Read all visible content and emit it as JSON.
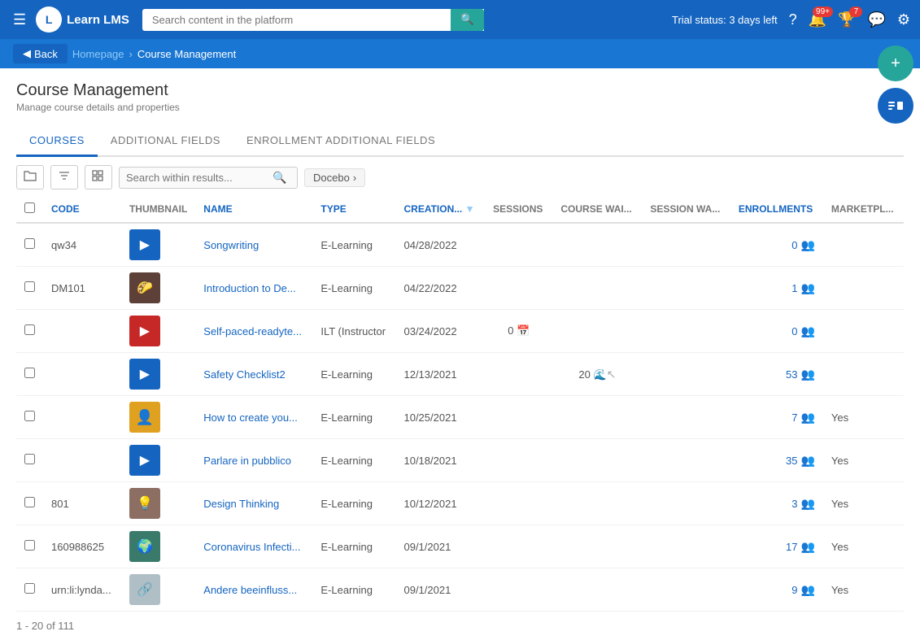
{
  "topNav": {
    "logoText": "L",
    "appName": "Learn LMS",
    "searchPlaceholder": "Search content in the platform",
    "trialStatus": "Trial status: 3 days left",
    "notifBadge": "99+",
    "rewardBadge": "7"
  },
  "breadcrumb": {
    "backLabel": "Back",
    "homepageLabel": "Homepage",
    "currentLabel": "Course Management"
  },
  "page": {
    "title": "Course Management",
    "subtitle": "Manage course details and properties"
  },
  "tabs": [
    {
      "label": "COURSES",
      "active": true
    },
    {
      "label": "ADDITIONAL FIELDS",
      "active": false
    },
    {
      "label": "ENROLLMENT ADDITIONAL FIELDS",
      "active": false
    }
  ],
  "toolbar": {
    "searchPlaceholder": "Search within results...",
    "doceboTag": "Docebo"
  },
  "table": {
    "columns": [
      "CODE",
      "THUMBNAIL",
      "NAME",
      "TYPE",
      "CREATION...",
      "SESSIONS",
      "COURSE WAI...",
      "SESSION WA...",
      "ENROLLMENTS",
      "MARKETPL..."
    ],
    "rows": [
      {
        "code": "qw34",
        "thumbType": "blue",
        "thumbIcon": "▶",
        "name": "Songwriting",
        "type": "E-Learning",
        "creation": "04/28/2022",
        "sessions": "",
        "courseWai": "",
        "sessionWa": "",
        "enrollments": "0",
        "marketplace": ""
      },
      {
        "code": "DM101",
        "thumbType": "photo",
        "thumbIcon": "👤",
        "name": "Introduction to De...",
        "type": "E-Learning",
        "creation": "04/22/2022",
        "sessions": "",
        "courseWai": "",
        "sessionWa": "",
        "enrollments": "1",
        "marketplace": ""
      },
      {
        "code": "",
        "thumbType": "red",
        "thumbIcon": "▶",
        "name": "Self-paced-readyte...",
        "type": "ILT (Instructor",
        "creation": "03/24/2022",
        "sessions": "0",
        "courseWai": "",
        "sessionWa": "",
        "enrollments": "0",
        "marketplace": ""
      },
      {
        "code": "",
        "thumbType": "blue",
        "thumbIcon": "▶",
        "name": "Safety Checklist2",
        "type": "E-Learning",
        "creation": "12/13/2021",
        "sessions": "",
        "courseWai": "20",
        "sessionWa": "",
        "enrollments": "53",
        "marketplace": ""
      },
      {
        "code": "",
        "thumbType": "yellow",
        "thumbIcon": "👤",
        "name": "How to create you...",
        "type": "E-Learning",
        "creation": "10/25/2021",
        "sessions": "",
        "courseWai": "",
        "sessionWa": "",
        "enrollments": "7",
        "marketplace": "Yes"
      },
      {
        "code": "",
        "thumbType": "blue",
        "thumbIcon": "▶",
        "name": "Parlare in pubblico",
        "type": "E-Learning",
        "creation": "10/18/2021",
        "sessions": "",
        "courseWai": "",
        "sessionWa": "",
        "enrollments": "35",
        "marketplace": "Yes"
      },
      {
        "code": "801",
        "thumbType": "photo",
        "thumbIcon": "🖼",
        "name": "Design Thinking",
        "type": "E-Learning",
        "creation": "10/12/2021",
        "sessions": "",
        "courseWai": "",
        "sessionWa": "",
        "enrollments": "3",
        "marketplace": "Yes"
      },
      {
        "code": "160988625",
        "thumbType": "photo",
        "thumbIcon": "🌍",
        "name": "Coronavirus Infecti...",
        "type": "E-Learning",
        "creation": "09/1/2021",
        "sessions": "",
        "courseWai": "",
        "sessionWa": "",
        "enrollments": "17",
        "marketplace": "Yes"
      },
      {
        "code": "urn:li:lynda...",
        "thumbType": "photo",
        "thumbIcon": "🔗",
        "name": "Andere beeinfluss...",
        "type": "E-Learning",
        "creation": "09/1/2021",
        "sessions": "",
        "courseWai": "",
        "sessionWa": "",
        "enrollments": "9",
        "marketplace": "Yes"
      }
    ]
  },
  "footer": {
    "label": "1 - 20 of 111"
  }
}
